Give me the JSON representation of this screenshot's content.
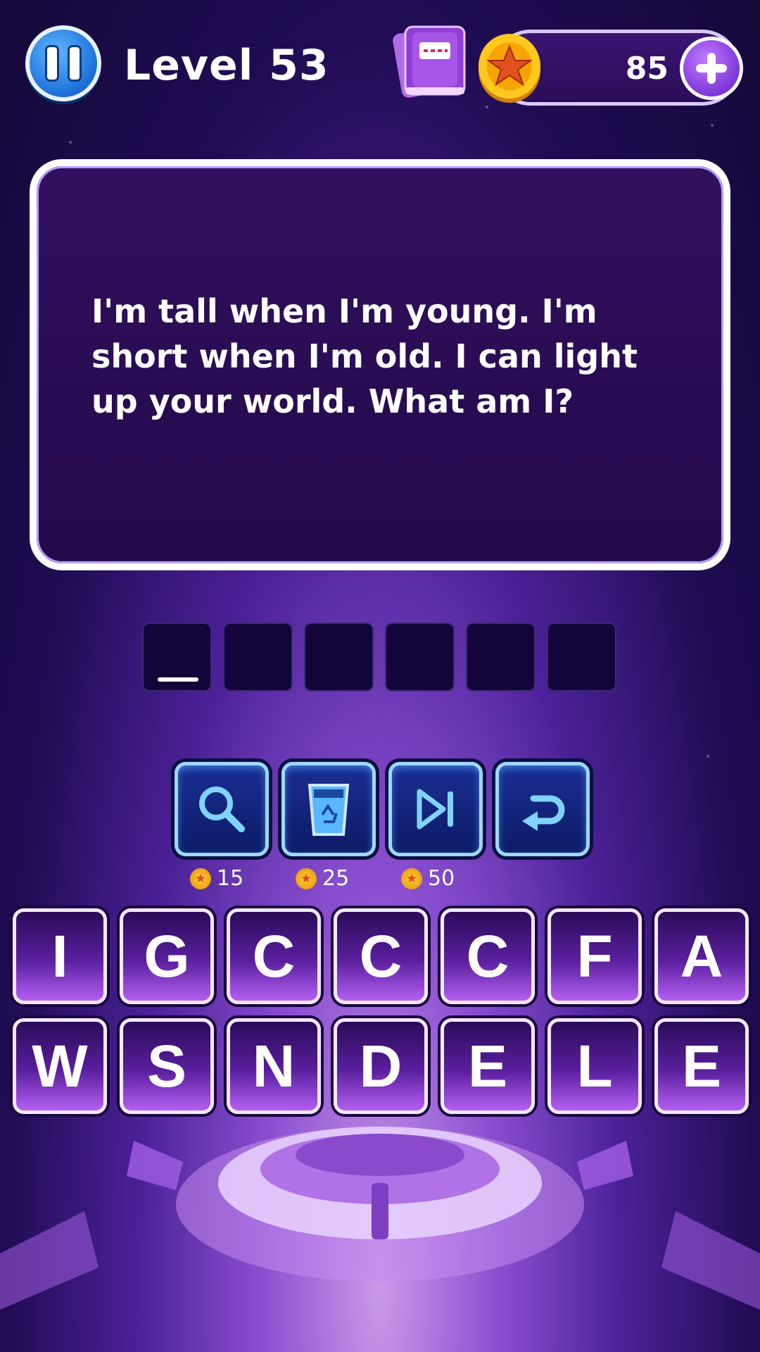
{
  "header": {
    "level_label": "Level 53",
    "coins": "85"
  },
  "riddle": {
    "text": "I'm tall when I'm young. I'm short when I'm old. I can light up your world. What am I?"
  },
  "answer": {
    "slot_count": 6
  },
  "powerups": [
    {
      "name": "magnifier-icon",
      "cost": "15"
    },
    {
      "name": "trash-icon",
      "cost": "25"
    },
    {
      "name": "skip-icon",
      "cost": "50"
    },
    {
      "name": "undo-icon",
      "cost": ""
    }
  ],
  "tiles": {
    "row1": [
      "I",
      "G",
      "C",
      "C",
      "C",
      "F",
      "A"
    ],
    "row2": [
      "W",
      "S",
      "N",
      "D",
      "E",
      "L",
      "E"
    ]
  },
  "colors": {
    "background": "#1f0c52",
    "tile_accent": "#b45ff2",
    "powerup_accent": "#9fd6ff"
  }
}
